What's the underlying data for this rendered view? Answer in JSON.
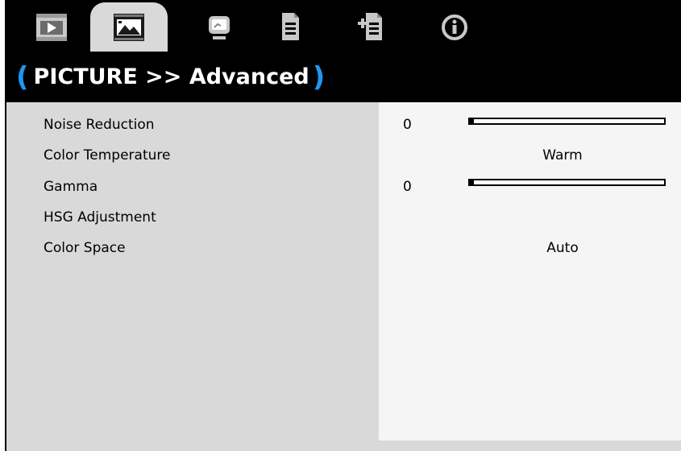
{
  "tabs": [
    {
      "name": "tab-display",
      "icon": "play-screen-icon",
      "active": false
    },
    {
      "name": "tab-picture",
      "icon": "picture-icon",
      "active": true
    },
    {
      "name": "tab-setup",
      "icon": "monitor-icon",
      "active": false
    },
    {
      "name": "tab-options",
      "icon": "document-icon",
      "active": false
    },
    {
      "name": "tab-options2",
      "icon": "document-plus-icon",
      "active": false
    },
    {
      "name": "tab-info",
      "icon": "info-icon",
      "active": false
    }
  ],
  "title": {
    "open": "(",
    "text": "PICTURE >> Advanced",
    "close": ")"
  },
  "menu": {
    "items": [
      {
        "label": "Noise Reduction",
        "value": "0",
        "slider": 0.02
      },
      {
        "label": "Color Temperature",
        "value": "Warm"
      },
      {
        "label": "Gamma",
        "value": "0",
        "slider": 0.02
      },
      {
        "label": "HSG Adjustment",
        "value": ""
      },
      {
        "label": "Color Space",
        "value": "Auto"
      }
    ]
  },
  "colors": {
    "bar": "#000000",
    "panel": "#d9d9d9",
    "value_pane": "#f5f5f5",
    "accent": "#1f96f0"
  }
}
